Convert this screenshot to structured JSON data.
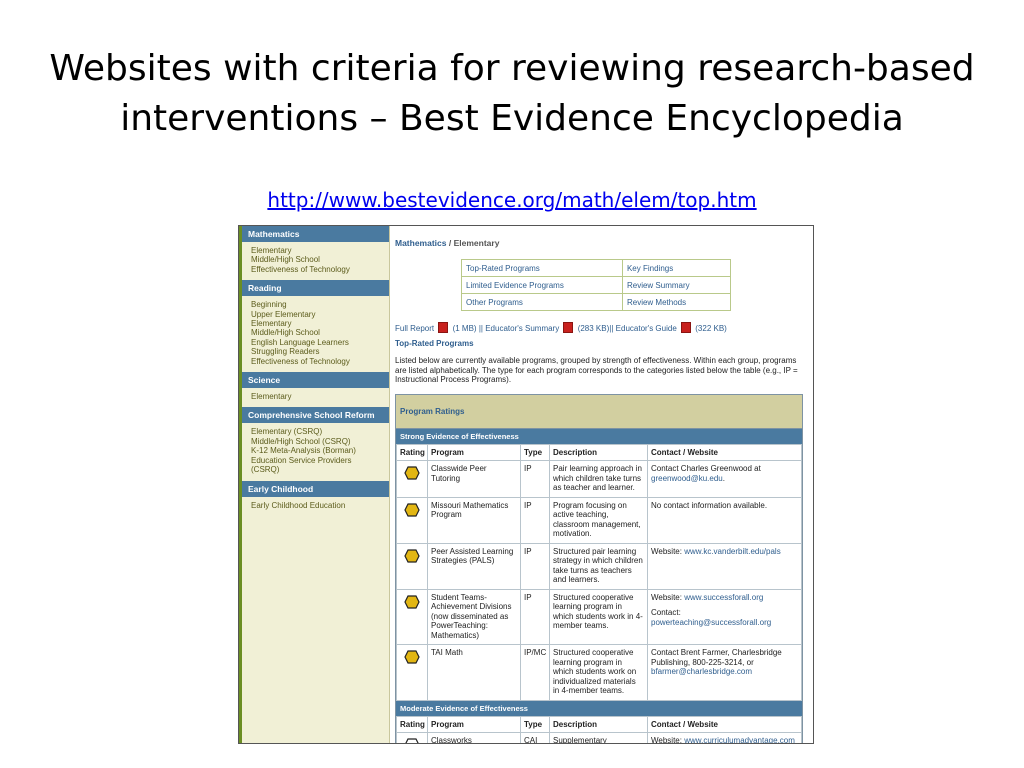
{
  "slide": {
    "title_line1": "Websites with criteria for reviewing research-based",
    "title_line2": "interventions – Best Evidence Encyclopedia",
    "url": "http://www.bestevidence.org/math/elem/top.htm"
  },
  "sidebar": [
    {
      "heading": "Mathematics",
      "items": [
        "Elementary",
        "Middle/High School",
        "Effectiveness of Technology"
      ]
    },
    {
      "heading": "Reading",
      "items": [
        "Beginning",
        "Upper Elementary",
        "Elementary",
        "Middle/High School",
        "English Language Learners",
        "Struggling Readers",
        "Effectiveness of Technology"
      ]
    },
    {
      "heading": "Science",
      "items": [
        "Elementary"
      ]
    },
    {
      "heading": "Comprehensive School Reform",
      "items": [
        "Elementary (CSRQ)",
        "Middle/High School (CSRQ)",
        "K-12 Meta-Analysis (Borman)",
        "Education Service Providers",
        "(CSRQ)"
      ]
    },
    {
      "heading": "Early Childhood",
      "items": [
        "Early Childhood Education"
      ]
    }
  ],
  "breadcrumb": {
    "first": "Mathematics",
    "separator": " / ",
    "second": "Elementary"
  },
  "nav_links": [
    [
      "Top-Rated Programs",
      "Key Findings"
    ],
    [
      "Limited Evidence Programs",
      "Review Summary"
    ],
    [
      "Other Programs",
      "Review Methods"
    ]
  ],
  "reports": {
    "full": "Full Report",
    "full_size": "(1 MB) ||",
    "summary": "Educator's Summary",
    "summary_size": "(283 KB)||",
    "guide": "Educator's Guide",
    "guide_size": "(322 KB)"
  },
  "section_title": "Top-Rated Programs",
  "intro": "Listed below are currently available programs, grouped by strength of effectiveness. Within each group, programs are listed alphabetically. The type for each program corresponds to the categories listed below the table (e.g., IP = Instructional Process Programs).",
  "ratings_title": "Program Ratings",
  "columns": [
    "Rating",
    "Program",
    "Type",
    "Description",
    "Contact / Website"
  ],
  "groups": [
    {
      "band": "Strong Evidence of Effectiveness",
      "badge": "full",
      "rows": [
        {
          "program": "Classwide Peer Tutoring",
          "type": "IP",
          "description": "Pair learning approach in which children take turns as teacher and learner.",
          "contact": "Contact Charles Greenwood at",
          "link": "greenwood@ku.edu",
          "tail": "."
        },
        {
          "program": "Missouri Mathematics Program",
          "type": "IP",
          "description": "Program focusing on active teaching, classroom management, motivation.",
          "contact": "No contact information available.",
          "link": "",
          "tail": ""
        },
        {
          "program": "Peer Assisted Learning Strategies (PALS)",
          "type": "IP",
          "description": "Structured pair learning strategy in which children take turns as teachers and learners.",
          "contact": "Website:",
          "link": "www.kc.vanderbilt.edu/pals",
          "tail": ""
        },
        {
          "program": "Student Teams-Achievement Divisions (now disseminated as PowerTeaching: Mathematics)",
          "type": "IP",
          "description": "Structured cooperative learning program in which students work in 4-member teams.",
          "contact": "Website:",
          "link": "www.successforall.org",
          "tail": "",
          "contact2": "Contact:",
          "link2": "powerteaching@successforall.org"
        },
        {
          "program": "TAI Math",
          "type": "IP/MC",
          "description": "Structured cooperative learning program in which students work on individualized materials in 4-member teams.",
          "contact": "Contact Brent Farmer, Charlesbridge Publishing, 800-225-3214, or",
          "link": "bfarmer@charlesbridge.com",
          "tail": ""
        }
      ]
    },
    {
      "band": "Moderate Evidence of Effectiveness",
      "badge": "half",
      "rows": [
        {
          "program": "Classworks",
          "type": "CAI",
          "description": "Supplementary integrated learning system.",
          "contact": "Website:",
          "link": "www.curriculumadvantage.com",
          "tail": ""
        }
      ]
    }
  ],
  "colors": {
    "heading_blue": "#4a7aa0",
    "sidebar_bg": "#f1f0d6",
    "link": "#2f5e8e",
    "badge": "#e2b613"
  }
}
